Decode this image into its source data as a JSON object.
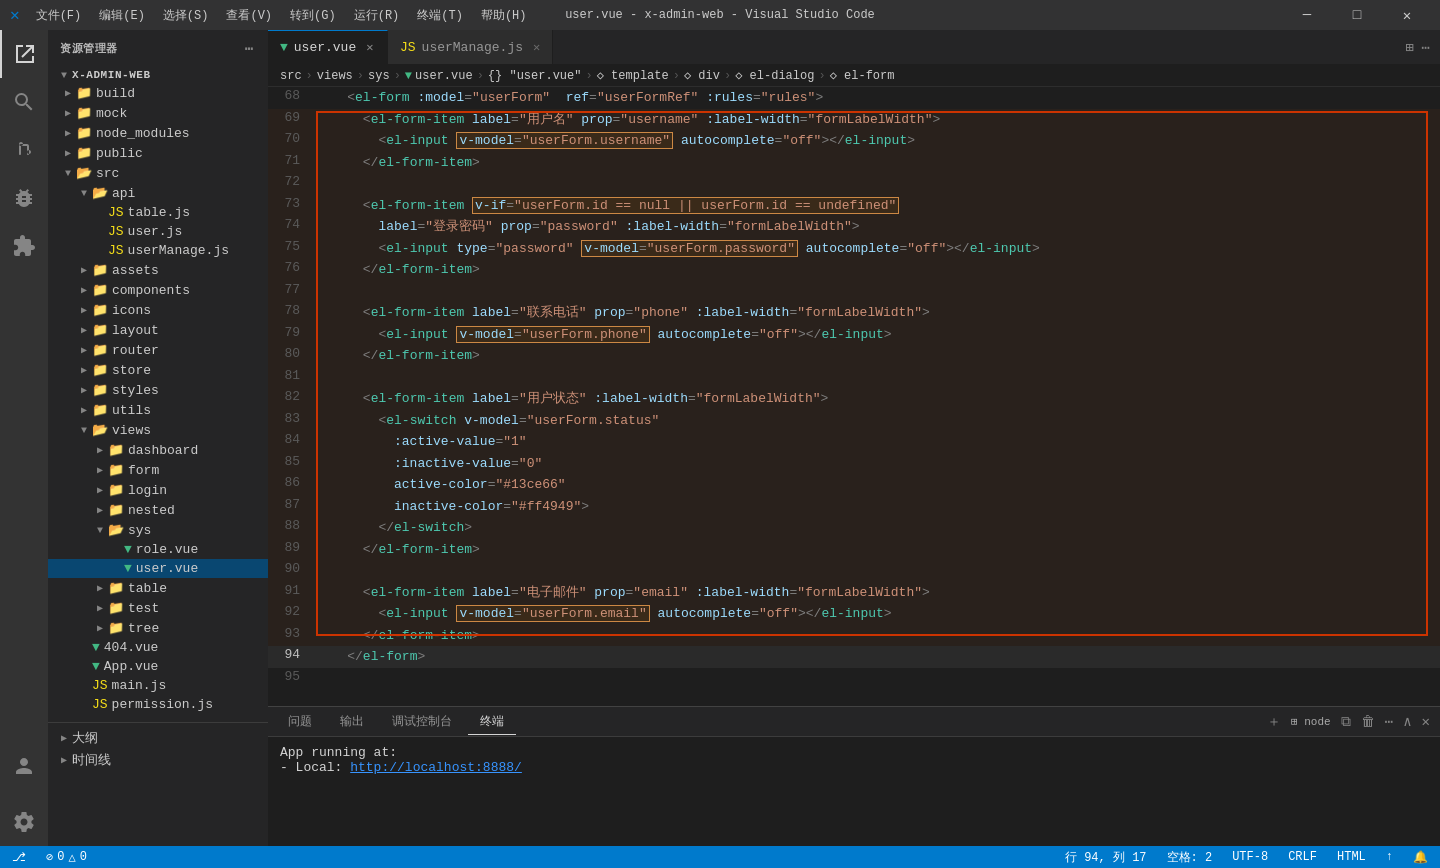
{
  "titleBar": {
    "icon": "✕",
    "menus": [
      "文件(F)",
      "编辑(E)",
      "选择(S)",
      "查看(V)",
      "转到(G)",
      "运行(R)",
      "终端(T)",
      "帮助(H)"
    ],
    "title": "user.vue - x-admin-web - Visual Studio Code",
    "controls": [
      "⬜",
      "❐",
      "▭",
      "✕"
    ]
  },
  "sidebar": {
    "header": "资源管理器",
    "root": "X-ADMIN-WEB",
    "items": [
      {
        "id": "build",
        "label": "build",
        "type": "folder",
        "depth": 1,
        "collapsed": true
      },
      {
        "id": "mock",
        "label": "mock",
        "type": "folder",
        "depth": 1,
        "collapsed": true
      },
      {
        "id": "node_modules",
        "label": "node_modules",
        "type": "folder",
        "depth": 1,
        "collapsed": true
      },
      {
        "id": "public",
        "label": "public",
        "type": "folder",
        "depth": 1,
        "collapsed": true
      },
      {
        "id": "src",
        "label": "src",
        "type": "folder",
        "depth": 1,
        "collapsed": false
      },
      {
        "id": "api",
        "label": "api",
        "type": "folder",
        "depth": 2,
        "collapsed": false
      },
      {
        "id": "table.js",
        "label": "table.js",
        "type": "js",
        "depth": 3
      },
      {
        "id": "user.js",
        "label": "user.js",
        "type": "js",
        "depth": 3
      },
      {
        "id": "userManage.js",
        "label": "userManage.js",
        "type": "js",
        "depth": 3
      },
      {
        "id": "assets",
        "label": "assets",
        "type": "folder",
        "depth": 2,
        "collapsed": true
      },
      {
        "id": "components",
        "label": "components",
        "type": "folder",
        "depth": 2,
        "collapsed": true
      },
      {
        "id": "icons",
        "label": "icons",
        "type": "folder",
        "depth": 2,
        "collapsed": true
      },
      {
        "id": "layout",
        "label": "layout",
        "type": "folder",
        "depth": 2,
        "collapsed": true
      },
      {
        "id": "router",
        "label": "router",
        "type": "folder",
        "depth": 2,
        "collapsed": true
      },
      {
        "id": "store",
        "label": "store",
        "type": "folder",
        "depth": 2,
        "collapsed": true
      },
      {
        "id": "styles",
        "label": "styles",
        "type": "folder",
        "depth": 2,
        "collapsed": true
      },
      {
        "id": "utils",
        "label": "utils",
        "type": "folder",
        "depth": 2,
        "collapsed": true
      },
      {
        "id": "views",
        "label": "views",
        "type": "folder",
        "depth": 2,
        "collapsed": false
      },
      {
        "id": "dashboard",
        "label": "dashboard",
        "type": "folder",
        "depth": 3,
        "collapsed": true
      },
      {
        "id": "form",
        "label": "form",
        "type": "folder",
        "depth": 3,
        "collapsed": true
      },
      {
        "id": "login",
        "label": "login",
        "type": "folder",
        "depth": 3,
        "collapsed": true
      },
      {
        "id": "nested",
        "label": "nested",
        "type": "folder",
        "depth": 3,
        "collapsed": true
      },
      {
        "id": "sys",
        "label": "sys",
        "type": "folder",
        "depth": 3,
        "collapsed": false
      },
      {
        "id": "role.vue",
        "label": "role.vue",
        "type": "vue",
        "depth": 4
      },
      {
        "id": "user.vue",
        "label": "user.vue",
        "type": "vue",
        "depth": 4,
        "active": true
      },
      {
        "id": "table",
        "label": "table",
        "type": "folder",
        "depth": 3,
        "collapsed": true
      },
      {
        "id": "test",
        "label": "test",
        "type": "folder",
        "depth": 3,
        "collapsed": true
      },
      {
        "id": "tree",
        "label": "tree",
        "type": "folder",
        "depth": 3,
        "collapsed": true
      },
      {
        "id": "404.vue",
        "label": "404.vue",
        "type": "vue",
        "depth": 2
      },
      {
        "id": "App.vue",
        "label": "App.vue",
        "type": "vue",
        "depth": 2
      },
      {
        "id": "main.js",
        "label": "main.js",
        "type": "js",
        "depth": 2
      },
      {
        "id": "permission.js",
        "label": "permission.js",
        "type": "js",
        "depth": 2
      }
    ]
  },
  "tabs": [
    {
      "label": "user.vue",
      "type": "vue",
      "active": true
    },
    {
      "label": "userManage.js",
      "type": "js",
      "active": false
    }
  ],
  "breadcrumb": {
    "parts": [
      "src",
      "views",
      "sys",
      "user.vue",
      "{} \"user.vue\"",
      "◇ template",
      "◇ div",
      "◇ el-dialog",
      "◇ el-form"
    ]
  },
  "codeLines": [
    {
      "num": 68,
      "content": "    <el-form :model=\"userForm\"  ref=\"userFormRef\" :rules=\"rules\">"
    },
    {
      "num": 69,
      "content": "      <el-form-item label=\"用户名\" prop=\"username\" :label-width=\"formLabelWidth\">"
    },
    {
      "num": 70,
      "content": "        <el-input v-model=\"userForm.username\" autocomplete=\"off\"></el-input>"
    },
    {
      "num": 71,
      "content": "      </el-form-item>"
    },
    {
      "num": 72,
      "content": ""
    },
    {
      "num": 73,
      "content": "      <el-form-item v-if=\"userForm.id == null || userForm.id == undefined\""
    },
    {
      "num": 74,
      "content": "        label=\"登录密码\" prop=\"password\" :label-width=\"formLabelWidth\">"
    },
    {
      "num": 75,
      "content": "        <el-input type=\"password\" v-model=\"userForm.password\" autocomplete=\"off\"></el-input>"
    },
    {
      "num": 76,
      "content": "      </el-form-item>"
    },
    {
      "num": 77,
      "content": ""
    },
    {
      "num": 78,
      "content": "      <el-form-item label=\"联系电话\" prop=\"phone\" :label-width=\"formLabelWidth\">"
    },
    {
      "num": 79,
      "content": "        <el-input v-model=\"userForm.phone\" autocomplete=\"off\"></el-input>"
    },
    {
      "num": 80,
      "content": "      </el-form-item>"
    },
    {
      "num": 81,
      "content": ""
    },
    {
      "num": 82,
      "content": "      <el-form-item label=\"用户状态\" :label-width=\"formLabelWidth\">"
    },
    {
      "num": 83,
      "content": "        <el-switch v-model=\"userForm.status\""
    },
    {
      "num": 84,
      "content": "          :active-value=\"1\""
    },
    {
      "num": 85,
      "content": "          :inactive-value=\"0\""
    },
    {
      "num": 86,
      "content": "          active-color=\"#13ce66\""
    },
    {
      "num": 87,
      "content": "          inactive-color=\"#ff4949\">"
    },
    {
      "num": 88,
      "content": "        </el-switch>"
    },
    {
      "num": 89,
      "content": "      </el-form-item>"
    },
    {
      "num": 90,
      "content": ""
    },
    {
      "num": 91,
      "content": "      <el-form-item label=\"电子邮件\" prop=\"email\" :label-width=\"formLabelWidth\">"
    },
    {
      "num": 92,
      "content": "        <el-input v-model=\"userForm.email\" autocomplete=\"off\"></el-input>"
    },
    {
      "num": 93,
      "content": "      </el-form-item>"
    },
    {
      "num": 94,
      "content": "    </el-form>"
    },
    {
      "num": 95,
      "content": ""
    }
  ],
  "terminal": {
    "tabs": [
      "问题",
      "输出",
      "调试控制台",
      "终端"
    ],
    "activeTab": "终端",
    "content": [
      "App running at:",
      "  - Local:    http://localhost:8888/"
    ]
  },
  "statusBar": {
    "left": [
      "⎇",
      "0△",
      "0⊘"
    ],
    "position": "行 94, 列 17",
    "spaces": "空格: 2",
    "encoding": "UTF-8",
    "lineEnding": "CRLF",
    "language": "HTML",
    "sync": "↑",
    "notification": "🔔"
  }
}
